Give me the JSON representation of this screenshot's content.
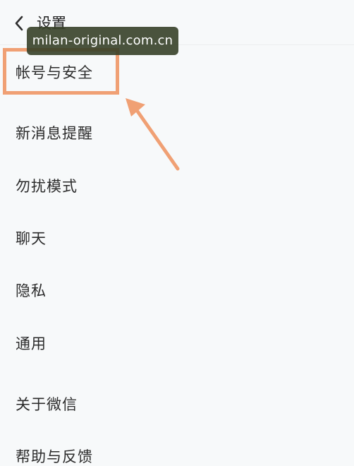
{
  "header": {
    "title": "设置"
  },
  "watermark": {
    "text": "milan-original.com.cn"
  },
  "menu": [
    {
      "label": "帐号与安全",
      "name": "menu-item-account-security"
    },
    {
      "label": "新消息提醒",
      "name": "menu-item-new-message-alerts"
    },
    {
      "label": "勿扰模式",
      "name": "menu-item-do-not-disturb"
    },
    {
      "label": "聊天",
      "name": "menu-item-chat"
    },
    {
      "label": "隐私",
      "name": "menu-item-privacy"
    },
    {
      "label": "通用",
      "name": "menu-item-general"
    },
    {
      "label": "关于微信",
      "name": "menu-item-about-wechat"
    },
    {
      "label": "帮助与反馈",
      "name": "menu-item-help-feedback"
    }
  ],
  "annotation": {
    "highlight_color": "#f0a074",
    "target": "帐号与安全"
  },
  "icons": {
    "back": "chevron-left-icon",
    "annotation_arrow": "arrow-up-left-icon"
  },
  "colors": {
    "background": "#f7f9fa",
    "text": "#2b2b2b",
    "watermark_bg": "#364028"
  }
}
